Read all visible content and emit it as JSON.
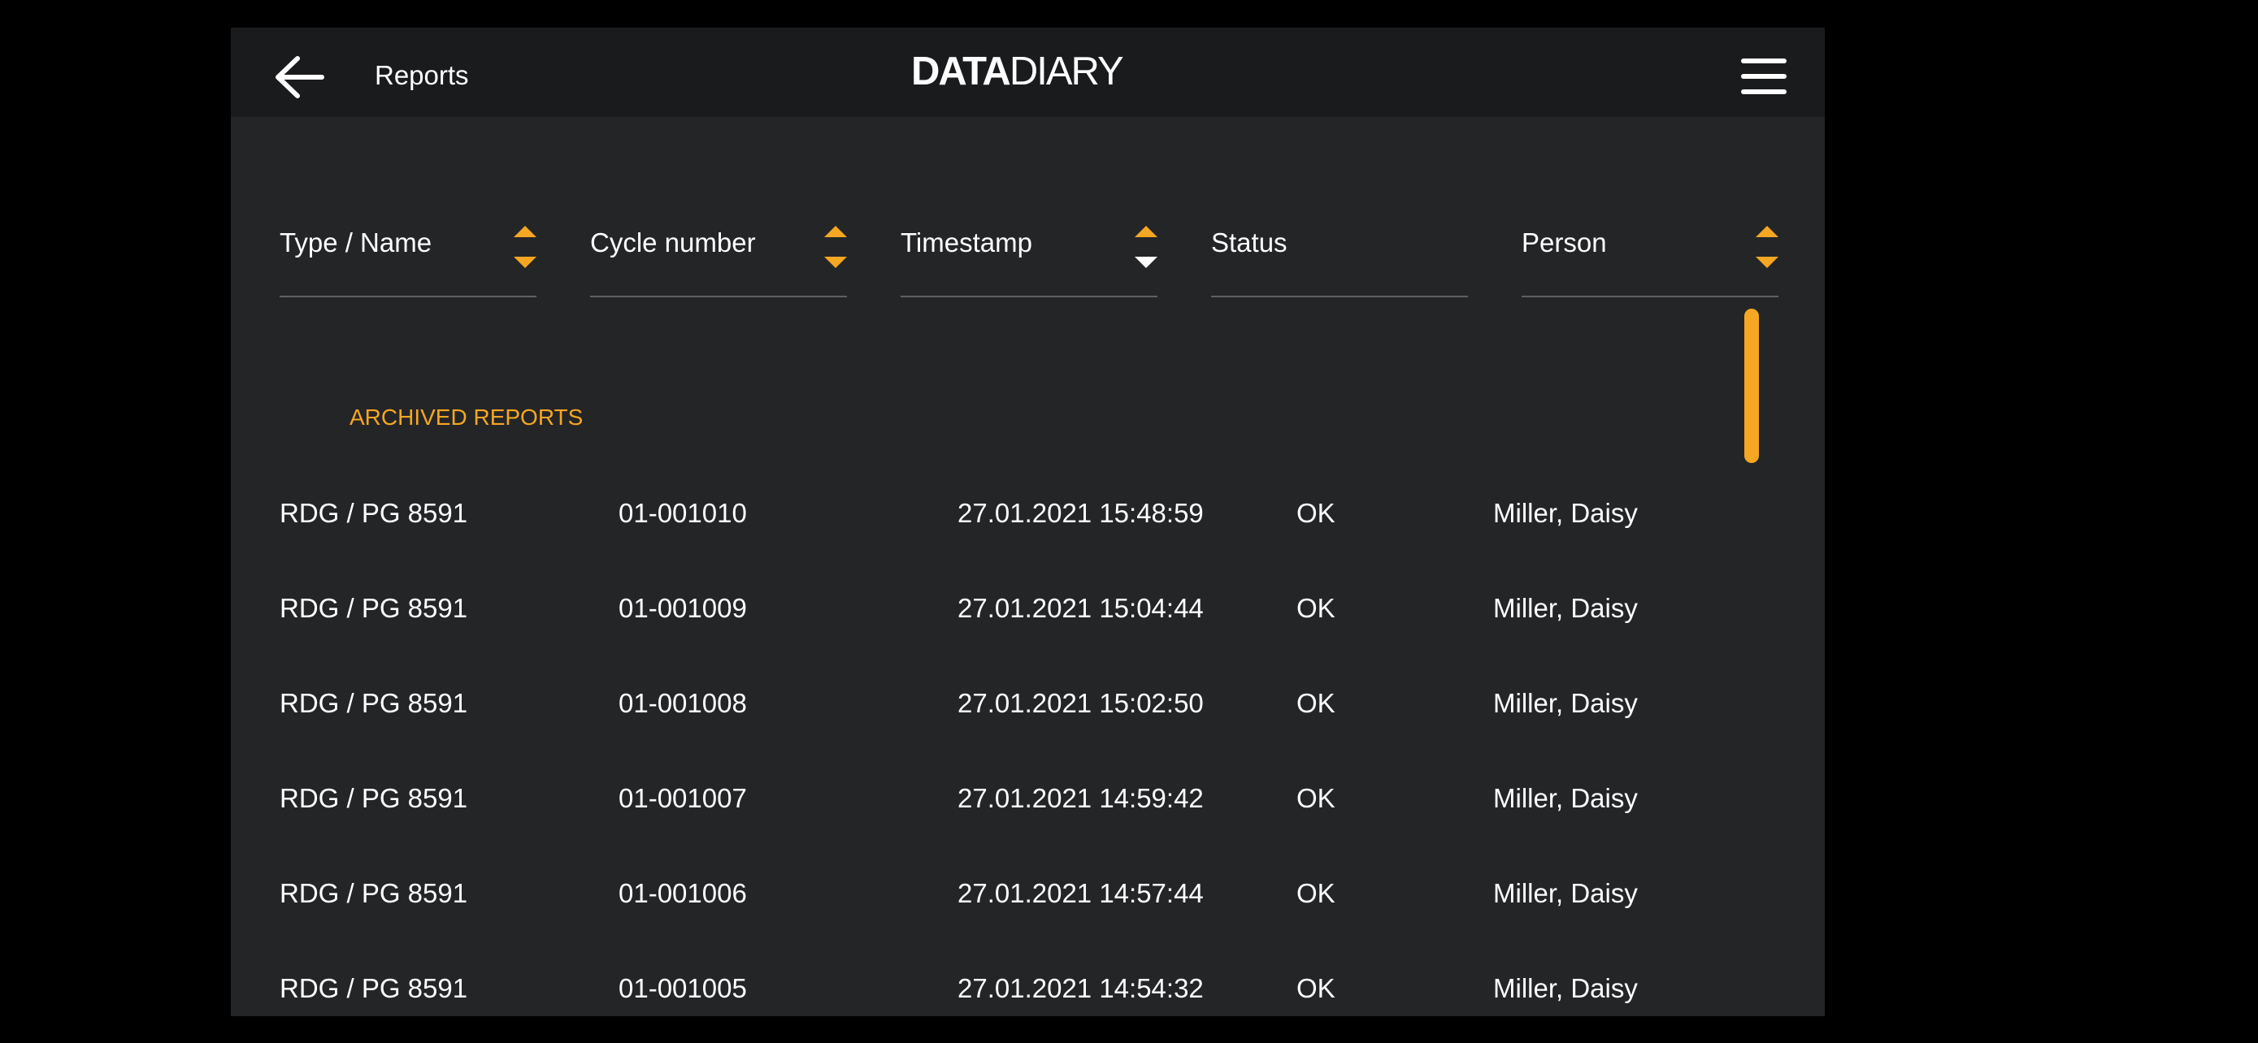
{
  "header": {
    "back_icon": "arrow-left-icon",
    "title": "Reports",
    "logo_strong": "DATA",
    "logo_light": "DIARY",
    "menu_icon": "hamburger-menu-icon"
  },
  "columns": [
    {
      "label": "Type / Name",
      "sort": "both"
    },
    {
      "label": "Cycle number",
      "sort": "both"
    },
    {
      "label": "Timestamp",
      "sort": "descending"
    },
    {
      "label": "Status",
      "sort": "none"
    },
    {
      "label": "Person",
      "sort": "both"
    }
  ],
  "section_title": "ARCHIVED REPORTS",
  "rows": [
    {
      "type": "RDG / PG 8591",
      "cycle": "01-001010",
      "timestamp": "27.01.2021 15:48:59",
      "status": "OK",
      "person": "Miller, Daisy"
    },
    {
      "type": "RDG / PG 8591",
      "cycle": "01-001009",
      "timestamp": "27.01.2021 15:04:44",
      "status": "OK",
      "person": "Miller, Daisy"
    },
    {
      "type": "RDG / PG 8591",
      "cycle": "01-001008",
      "timestamp": "27.01.2021 15:02:50",
      "status": "OK",
      "person": "Miller, Daisy"
    },
    {
      "type": "RDG / PG 8591",
      "cycle": "01-001007",
      "timestamp": "27.01.2021 14:59:42",
      "status": "OK",
      "person": "Miller, Daisy"
    },
    {
      "type": "RDG / PG 8591",
      "cycle": "01-001006",
      "timestamp": "27.01.2021 14:57:44",
      "status": "OK",
      "person": "Miller, Daisy"
    },
    {
      "type": "RDG / PG 8591",
      "cycle": "01-001005",
      "timestamp": "27.01.2021 14:54:32",
      "status": "OK",
      "person": "Miller, Daisy"
    }
  ],
  "colors": {
    "accent": "#f5a623",
    "background": "#242527",
    "topbar": "#1a1b1d",
    "text": "#ffffff"
  }
}
